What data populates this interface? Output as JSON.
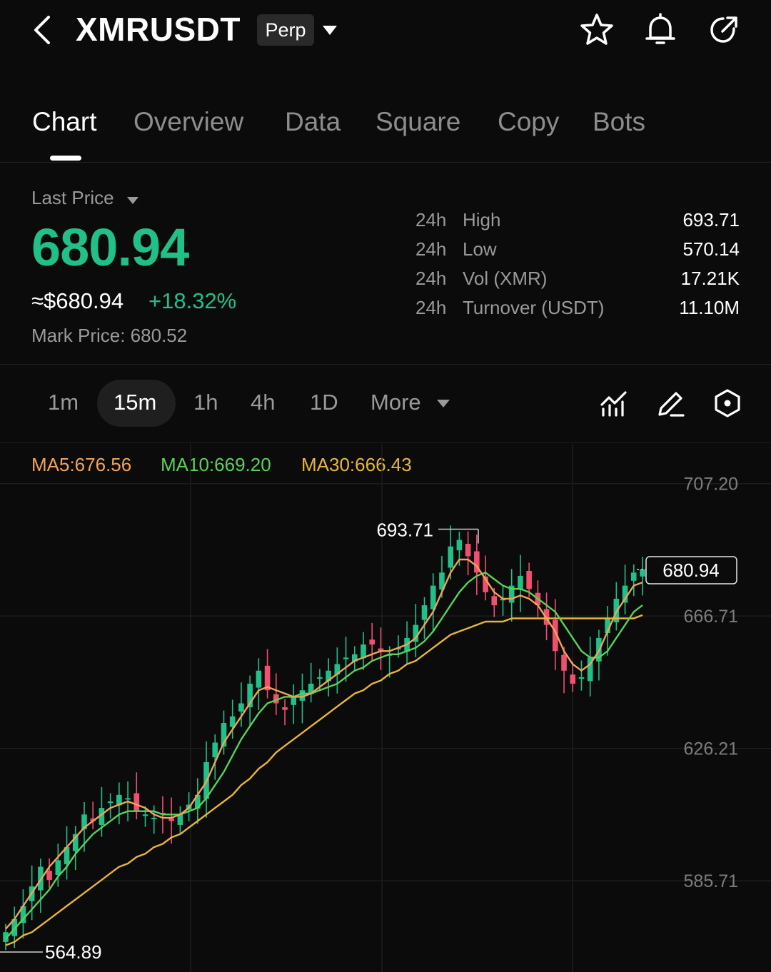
{
  "header": {
    "symbol": "XMRUSDT",
    "badge": "Perp",
    "icons": [
      "back-icon",
      "star-icon",
      "bell-icon",
      "share-icon"
    ]
  },
  "tabs": [
    {
      "label": "Chart",
      "active": true
    },
    {
      "label": "Overview",
      "active": false
    },
    {
      "label": "Data",
      "active": false
    },
    {
      "label": "Square",
      "active": false
    },
    {
      "label": "Copy",
      "active": false
    },
    {
      "label": "Bots",
      "active": false
    }
  ],
  "price": {
    "label": "Last Price",
    "last": "680.94",
    "approx": "≈$680.94",
    "change": "+18.32%",
    "mark": "Mark Price:  680.52"
  },
  "stats": [
    {
      "period": "24h",
      "label": "High",
      "value": "693.71"
    },
    {
      "period": "24h",
      "label": "Low",
      "value": "570.14"
    },
    {
      "period": "24h",
      "label": "Vol (XMR)",
      "value": "17.21K"
    },
    {
      "period": "24h",
      "label": "Turnover (USDT)",
      "value": "11.10M"
    }
  ],
  "intervals": [
    {
      "label": "1m",
      "active": false
    },
    {
      "label": "15m",
      "active": true
    },
    {
      "label": "1h",
      "active": false
    },
    {
      "label": "4h",
      "active": false
    },
    {
      "label": "1D",
      "active": false
    }
  ],
  "more_label": "More",
  "tools": [
    "indicators-icon",
    "draw-icon",
    "settings-hexagon-icon"
  ],
  "colors": {
    "up": "#21c087",
    "down": "#f0506e",
    "ma5": "#f0a35a",
    "ma10": "#5bd05b",
    "ma30": "#e8b53a",
    "background": "#0b0b0b"
  },
  "ma": {
    "ma5": "MA5:676.56",
    "ma10": "MA10:669.20",
    "ma30": "MA30:666.43"
  },
  "chart_data": {
    "type": "candlestick",
    "ylim": [
      560,
      715
    ],
    "y_ticks": [
      "707.20",
      "666.71",
      "626.21",
      "585.71"
    ],
    "high_marker": "693.71",
    "low_marker": "564.89",
    "last_price_tag": "680.94",
    "close_series": [
      570,
      574,
      578,
      584,
      590,
      586,
      592,
      596,
      600,
      606,
      604,
      608,
      610,
      612,
      611,
      607,
      606,
      605,
      606,
      604,
      606,
      609,
      612,
      622,
      628,
      634,
      636,
      640,
      646,
      650,
      644,
      640,
      638,
      642,
      644,
      646,
      648,
      650,
      652,
      654,
      655,
      658,
      658,
      656,
      655,
      657,
      660,
      664,
      670,
      676,
      680,
      688,
      690,
      685,
      680,
      674,
      670,
      672,
      676,
      679,
      675,
      670,
      664,
      656,
      650,
      646,
      648,
      654,
      660,
      666,
      672,
      676,
      680,
      681
    ],
    "ma5": [
      571,
      574,
      578,
      582,
      586,
      590,
      593,
      596,
      599,
      602,
      604,
      606,
      608,
      609,
      610,
      609,
      608,
      606,
      605,
      605,
      606,
      608,
      612,
      616,
      622,
      628,
      632,
      636,
      640,
      644,
      645,
      644,
      643,
      642,
      642,
      643,
      645,
      647,
      649,
      651,
      653,
      654,
      655,
      656,
      656,
      657,
      658,
      660,
      664,
      668,
      674,
      680,
      684,
      684,
      682,
      678,
      674,
      672,
      672,
      673,
      672,
      670,
      666,
      662,
      656,
      652,
      650,
      652,
      656,
      662,
      668,
      672,
      676,
      677
    ],
    "ma10": [
      568,
      571,
      574,
      577,
      580,
      583,
      587,
      590,
      594,
      597,
      600,
      602,
      604,
      606,
      607,
      607,
      607,
      607,
      606,
      606,
      606,
      607,
      608,
      611,
      615,
      619,
      624,
      629,
      633,
      637,
      640,
      641,
      642,
      642,
      643,
      643,
      644,
      645,
      646,
      648,
      650,
      651,
      653,
      654,
      655,
      655,
      656,
      657,
      659,
      662,
      666,
      670,
      674,
      677,
      679,
      680,
      678,
      676,
      675,
      675,
      674,
      672,
      670,
      668,
      664,
      660,
      656,
      654,
      654,
      656,
      660,
      664,
      668,
      670
    ],
    "ma30": [
      566,
      567,
      569,
      570,
      572,
      574,
      576,
      578,
      580,
      582,
      584,
      586,
      588,
      590,
      591,
      593,
      594,
      596,
      597,
      599,
      600,
      602,
      604,
      606,
      608,
      610,
      612,
      615,
      617,
      620,
      622,
      625,
      627,
      629,
      631,
      633,
      635,
      637,
      639,
      641,
      643,
      644,
      646,
      647,
      649,
      650,
      652,
      653,
      655,
      657,
      659,
      661,
      662,
      663,
      664,
      665,
      665,
      665,
      666,
      666,
      666,
      666,
      666,
      666,
      666,
      666,
      666,
      666,
      666,
      666,
      666,
      666,
      666,
      667
    ]
  }
}
